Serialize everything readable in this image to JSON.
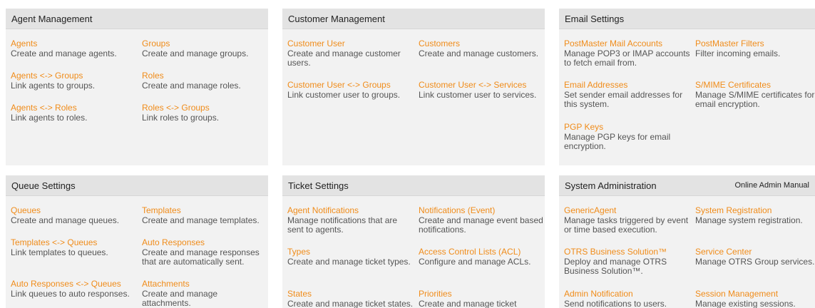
{
  "colors": {
    "link": "#f08c1a",
    "header_bg": "#e3e3e3",
    "card_bg": "#f2f2f2"
  },
  "agent_management": {
    "title": "Agent Management",
    "items": [
      {
        "label": "Agents",
        "desc": "Create and manage agents."
      },
      {
        "label": "Groups",
        "desc": "Create and manage groups."
      },
      {
        "label": "Agents <-> Groups",
        "desc": "Link agents to groups."
      },
      {
        "label": "Roles",
        "desc": "Create and manage roles."
      },
      {
        "label": "Agents <-> Roles",
        "desc": "Link agents to roles."
      },
      {
        "label": "Roles <-> Groups",
        "desc": "Link roles to groups."
      }
    ]
  },
  "customer_management": {
    "title": "Customer Management",
    "items": [
      {
        "label": "Customer User",
        "desc": "Create and manage customer users."
      },
      {
        "label": "Customers",
        "desc": "Create and manage customers."
      },
      {
        "label": "Customer User <-> Groups",
        "desc": "Link customer user to groups."
      },
      {
        "label": "Customer User <-> Services",
        "desc": "Link customer user to services."
      }
    ]
  },
  "email_settings": {
    "title": "Email Settings",
    "items": [
      {
        "label": "PostMaster Mail Accounts",
        "desc": "Manage POP3 or IMAP accounts to fetch email from."
      },
      {
        "label": "PostMaster Filters",
        "desc": "Filter incoming emails."
      },
      {
        "label": "Email Addresses",
        "desc": "Set sender email addresses for this system."
      },
      {
        "label": "S/MIME Certificates",
        "desc": "Manage S/MIME certificates for email encryption."
      },
      {
        "label": "PGP Keys",
        "desc": "Manage PGP keys for email encryption."
      }
    ]
  },
  "queue_settings": {
    "title": "Queue Settings",
    "items": [
      {
        "label": "Queues",
        "desc": "Create and manage queues."
      },
      {
        "label": "Templates",
        "desc": "Create and manage templates."
      },
      {
        "label": "Templates <-> Queues",
        "desc": "Link templates to queues."
      },
      {
        "label": "Auto Responses",
        "desc": "Create and manage responses that are automatically sent."
      },
      {
        "label": "Auto Responses <-> Queues",
        "desc": "Link queues to auto responses."
      },
      {
        "label": "Attachments",
        "desc": "Create and manage attachments."
      }
    ]
  },
  "ticket_settings": {
    "title": "Ticket Settings",
    "items": [
      {
        "label": "Agent Notifications",
        "desc": "Manage notifications that are sent to agents."
      },
      {
        "label": "Notifications (Event)",
        "desc": "Create and manage event based notifications."
      },
      {
        "label": "Types",
        "desc": "Create and manage ticket types."
      },
      {
        "label": "Access Control Lists (ACL)",
        "desc": "Configure and manage ACLs."
      },
      {
        "label": "States",
        "desc": "Create and manage ticket states."
      },
      {
        "label": "Priorities",
        "desc": "Create and manage ticket priorities."
      }
    ]
  },
  "system_administration": {
    "title": "System Administration",
    "manual_link": "Online Admin Manual",
    "items": [
      {
        "label": "GenericAgent",
        "desc": "Manage tasks triggered by event or time based execution."
      },
      {
        "label": "System Registration",
        "desc": "Manage system registration."
      },
      {
        "label": "OTRS Business Solution™",
        "desc": "Deploy and manage OTRS Business Solution™."
      },
      {
        "label": "Service Center",
        "desc": "Manage OTRS Group services."
      },
      {
        "label": "Admin Notification",
        "desc": "Send notifications to users."
      },
      {
        "label": "Session Management",
        "desc": "Manage existing sessions."
      }
    ]
  }
}
